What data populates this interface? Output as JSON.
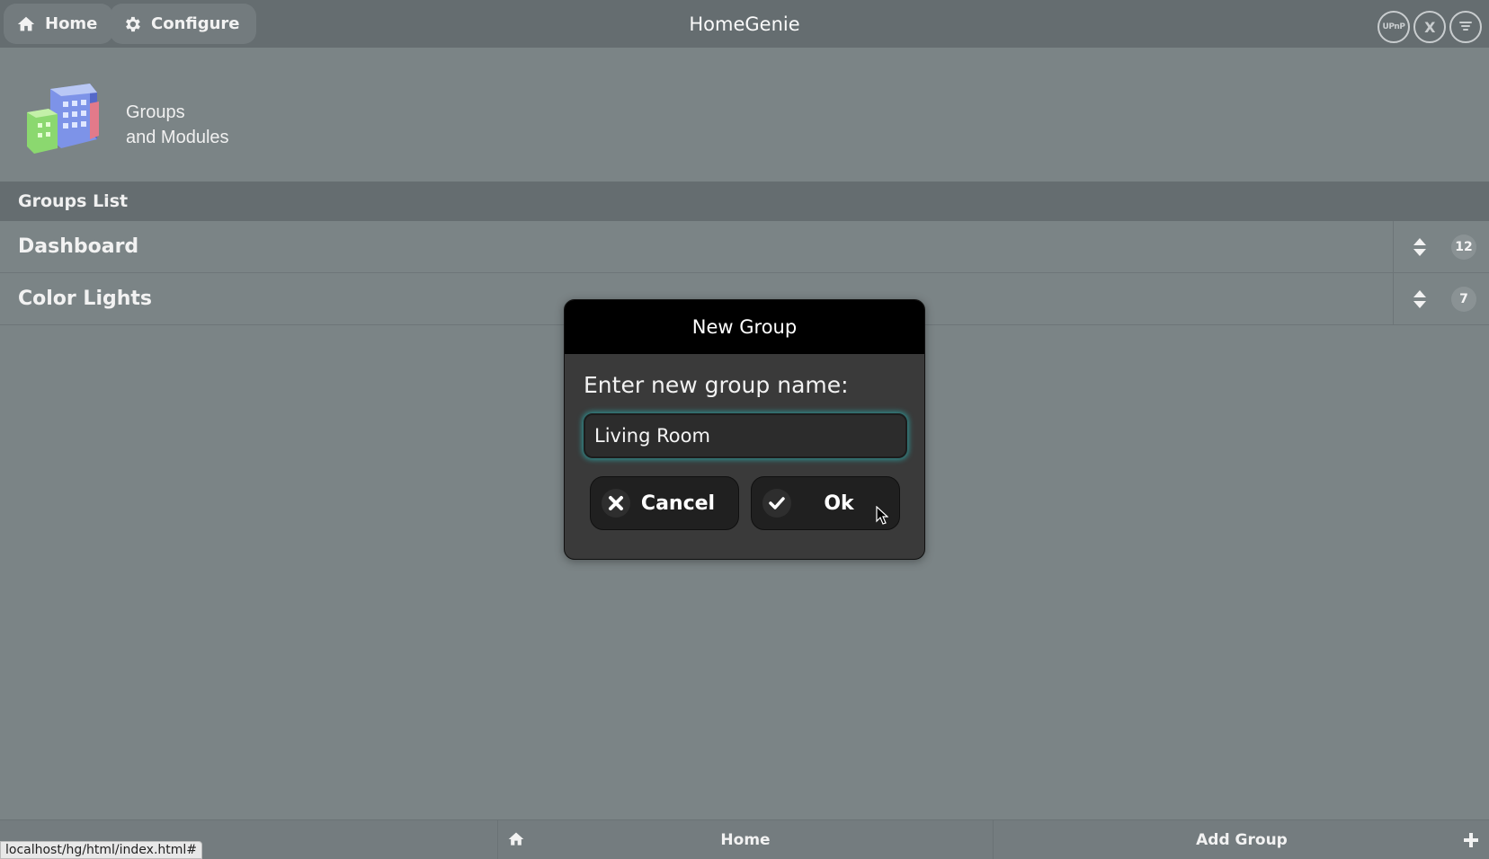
{
  "header": {
    "home_label": "Home",
    "configure_label": "Configure",
    "app_title": "HomeGenie",
    "right_icons": [
      "upnp-icon",
      "x10-icon",
      "zwave-icon"
    ],
    "upnp_text": "UPnP",
    "x10_text": "X"
  },
  "page": {
    "title_line1": "Groups",
    "title_line2": "and Modules"
  },
  "groups_list": {
    "header": "Groups List",
    "items": [
      {
        "name": "Dashboard",
        "count": "12"
      },
      {
        "name": "Color Lights",
        "count": "7"
      }
    ]
  },
  "modal": {
    "title": "New Group",
    "label": "Enter new group name:",
    "input_value": "Living Room",
    "cancel_label": "Cancel",
    "ok_label": "Ok",
    "input_glow_color": "#2f8a8a"
  },
  "bottombar": {
    "home_label": "Home",
    "add_group_label": "Add Group"
  },
  "status_url": "localhost/hg/html/index.html#",
  "colors": {
    "page_bg": "#7b8486",
    "bar_bg": "#656d70",
    "modal_bg": "#3a3a3a"
  }
}
